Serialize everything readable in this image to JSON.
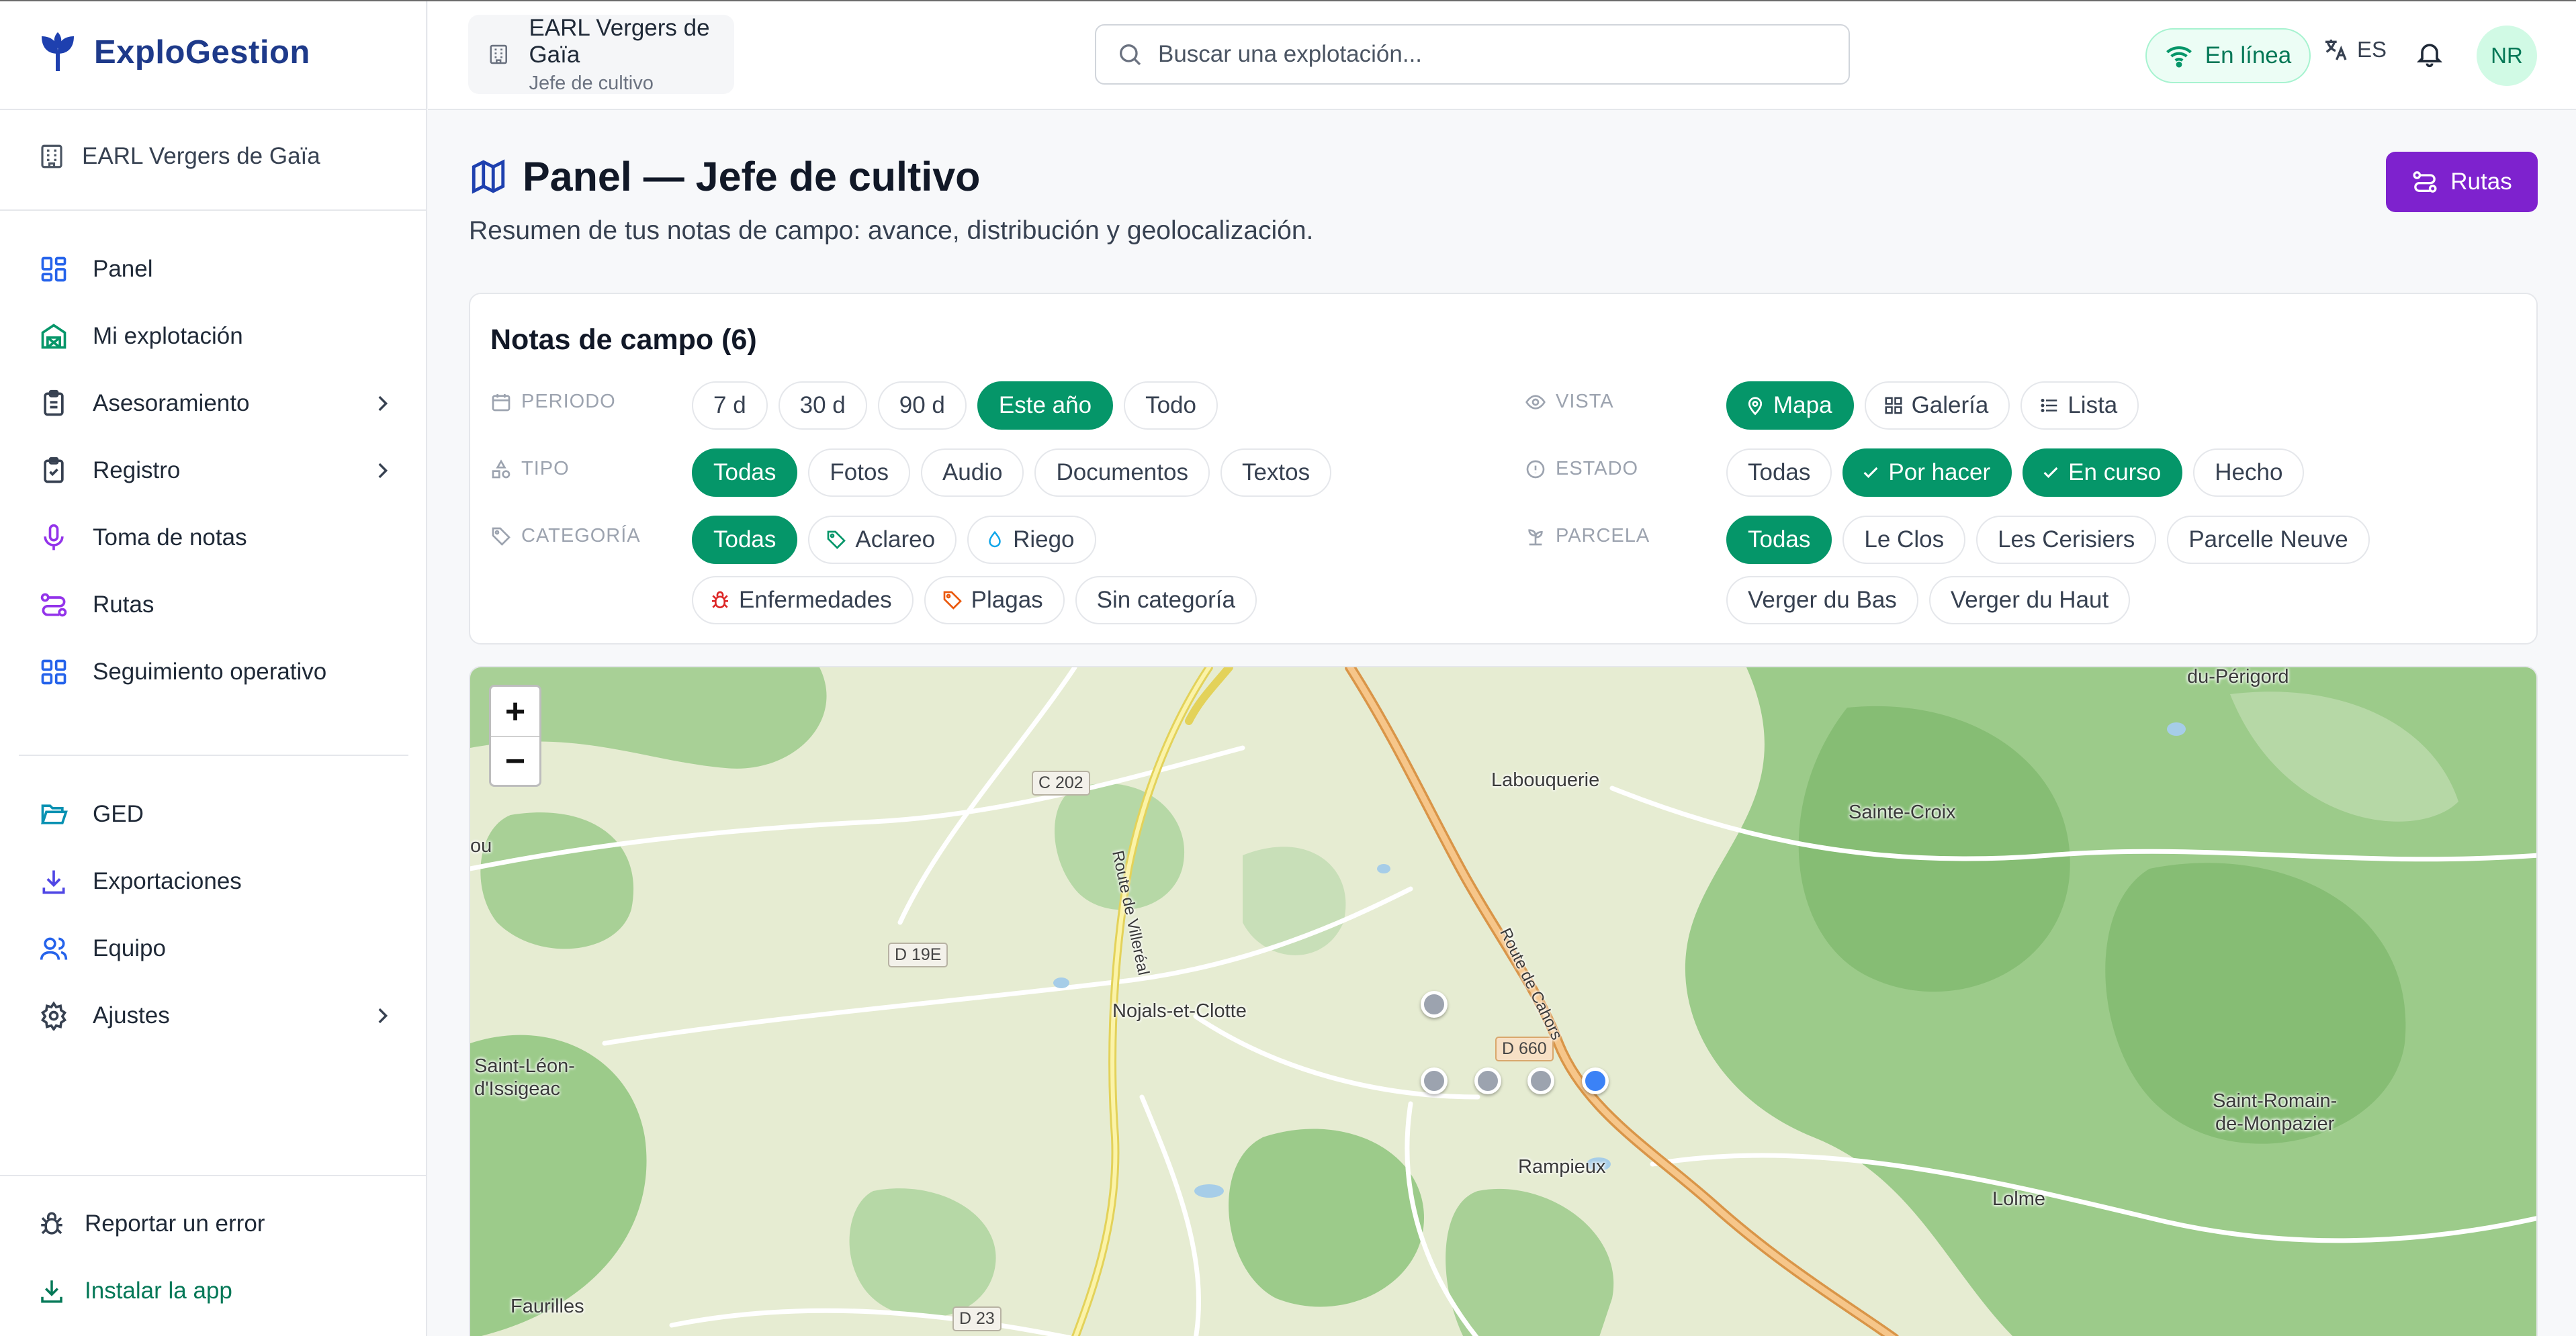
{
  "app": {
    "name": "ExploGestion",
    "accent": "#059669",
    "brand_color": "#1e3a8a"
  },
  "sidebar": {
    "org_name": "EARL Vergers de Gaïa",
    "nav": [
      {
        "label": "Panel",
        "icon": "dashboard-icon"
      },
      {
        "label": "Mi explotación",
        "icon": "farm-icon"
      },
      {
        "label": "Asesoramiento",
        "icon": "clipboard-icon"
      },
      {
        "label": "Registro",
        "icon": "clipboard-check-icon"
      },
      {
        "label": "Toma de notas",
        "icon": "microphone-icon"
      },
      {
        "label": "Rutas",
        "icon": "route-icon"
      },
      {
        "label": "Seguimiento operativo",
        "icon": "grid-icon"
      },
      {
        "label": "GED",
        "icon": "folder-open-icon"
      },
      {
        "label": "Exportaciones",
        "icon": "download-icon"
      },
      {
        "label": "Equipo",
        "icon": "users-icon"
      },
      {
        "label": "Ajustes",
        "icon": "gear-icon"
      }
    ],
    "report_bug": "Reportar un error",
    "install_app": "Instalar la app"
  },
  "topbar": {
    "org_name": "EARL Vergers de Gaïa",
    "role": "Jefe de cultivo",
    "search_placeholder": "Buscar una explotación...",
    "status": "En línea",
    "language": "ES",
    "avatar_initials": "NR"
  },
  "page": {
    "title": "Panel — Jefe de cultivo",
    "subtitle": "Resumen de tus notas de campo: avance, distribución y geolocalización.",
    "routes_button": "Rutas"
  },
  "notes": {
    "title": "Notas de campo (6)",
    "periodo_label": "PERIODO",
    "periodo": [
      "7 d",
      "30 d",
      "90 d",
      "Este año",
      "Todo"
    ],
    "tipo_label": "TIPO",
    "tipo": [
      "Todas",
      "Fotos",
      "Audio",
      "Documentos",
      "Textos"
    ],
    "categoria_label": "CATEGORÍA",
    "categoria": [
      "Todas",
      "Aclareo",
      "Riego",
      "Enfermedades",
      "Plagas",
      "Sin categoría"
    ],
    "vista_label": "VISTA",
    "vista": [
      "Mapa",
      "Galería",
      "Lista"
    ],
    "estado_label": "ESTADO",
    "estado": [
      "Todas",
      "Por hacer",
      "En curso",
      "Hecho"
    ],
    "parcela_label": "PARCELA",
    "parcela": [
      "Todas",
      "Le Clos",
      "Les Cerisiers",
      "Parcelle Neuve",
      "Verger du Bas",
      "Verger du Haut"
    ]
  },
  "map": {
    "zoom_in": "+",
    "zoom_out": "−",
    "places": [
      "Labouquerie",
      "Sainte-Croix",
      "Nojals-et-Clotte",
      "Saint-Léon-",
      "d'Issigeac",
      "Rampieux",
      "Saint-Romain-",
      "de-Monpazier",
      "Lolme",
      "Faurilles",
      "du-Périgord",
      "ou"
    ],
    "roads": [
      "C 202",
      "D 19E",
      "D 660",
      "D 23"
    ],
    "road_names": [
      "Route de Villeréal",
      "Route de Cahors"
    ],
    "marker_colors": {
      "grey": "#9ca3af",
      "blue": "#3b82f6"
    }
  }
}
